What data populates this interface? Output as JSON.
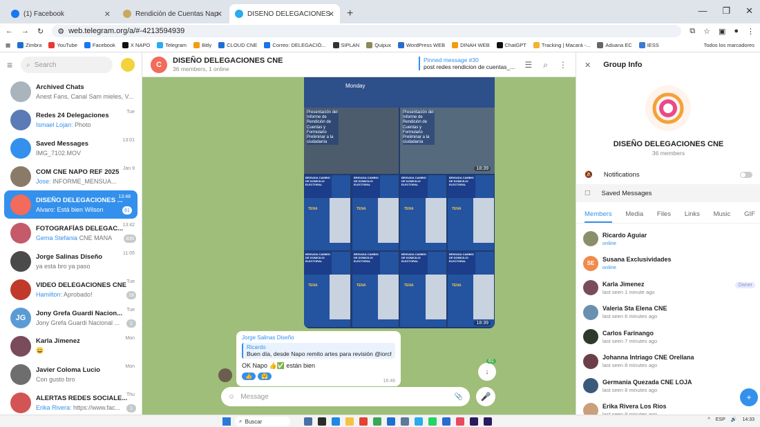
{
  "browser": {
    "tabs": [
      {
        "title": "(1) Facebook",
        "color": "#1877f2"
      },
      {
        "title": "Rendición de Cuentas Napo 20",
        "color": "#c9a95f"
      },
      {
        "title": "DISEÑO DELEGACIONES CNE",
        "color": "#2aabee"
      }
    ],
    "url": "web.telegram.org/a/#-4213594939",
    "bookmarks": [
      "Zimbra",
      "YouTube",
      "Facebook",
      "X NAPO",
      "Telegram",
      "Bitly",
      "CLOUD CNE",
      "Correo: DELEGACIÓ...",
      "SIPLAN",
      "Quipux",
      "WordPress WEB",
      "DINAH WEB",
      "ChatGPT",
      "Tracking | Macará -...",
      "Aduana EC",
      "IESS"
    ],
    "bookmarks_all": "Todos los marcadores"
  },
  "left": {
    "search_placeholder": "Search",
    "chats": [
      {
        "name": "Archived Chats",
        "preview": "Anest Fans, Canal Sam mieles, V...",
        "time": "",
        "badge": "",
        "sender": "",
        "color": "#aab4bd",
        "initials": ""
      },
      {
        "name": "Redes 24 Delegaciones",
        "preview": "Photo",
        "time": "Tue",
        "badge": "",
        "sender": "Ismael Lojan:",
        "color": "#5a7bb5",
        "initials": ""
      },
      {
        "name": "Saved Messages",
        "preview": "IMG_7102.MOV",
        "time": "13:01",
        "badge": "",
        "sender": "",
        "color": "#3390ec",
        "initials": ""
      },
      {
        "name": "COM CNE NAPO REF 2025",
        "preview": "INFORME_MENSUA...",
        "time": "Jan 9",
        "badge": "",
        "sender": "Jose:",
        "color": "#8a7b68",
        "initials": ""
      },
      {
        "name": "DISEÑO DELEGACIONES ...",
        "preview": "Está bien Wilson",
        "time": "13:48",
        "badge": "61",
        "sender": "Alvaro:",
        "color": "#f26b5b",
        "initials": ""
      },
      {
        "name": "FOTOGRAFÍAS DELEGAC...",
        "preview": "CNE MANA",
        "time": "13:42",
        "badge": "835",
        "sender": "Gema Stefania",
        "color": "#c45a6a",
        "initials": ""
      },
      {
        "name": "Jorge Salinas Diseño",
        "preview": "ya esta bro ya paso",
        "time": "11:05",
        "badge": "",
        "sender": "",
        "color": "#4a4a4a",
        "initials": ""
      },
      {
        "name": "VIDEO DELEGACIONES CNE",
        "preview": "Aprobado!",
        "time": "Tue",
        "badge": "18",
        "sender": "Hamilton:",
        "color": "#c0392b",
        "initials": ""
      },
      {
        "name": "Jony Grefa Guardi Nacion...",
        "preview": "Jony Grefa Guardi Nacional ...",
        "time": "Tue",
        "badge": "1",
        "sender": "",
        "color": "#5b9bd5",
        "initials": "JG"
      },
      {
        "name": "Karla Jimenez",
        "preview": "😀",
        "time": "Mon",
        "badge": "",
        "sender": "",
        "color": "#7a4b5a",
        "initials": ""
      },
      {
        "name": "Javier Coloma Lucio",
        "preview": "Con gusto bro",
        "time": "Mon",
        "badge": "",
        "sender": "",
        "color": "#6e6e6e",
        "initials": ""
      },
      {
        "name": "ALERTAS REDES SOCIALE...",
        "preview": "https://www.fac...",
        "time": "Thu",
        "badge": "1",
        "sender": "Erika Rivera:",
        "color": "#d35454",
        "initials": ""
      }
    ]
  },
  "middle": {
    "title": "DISEÑO DELEGACIONES CNE",
    "subtitle": "36 members, 1 online",
    "pinned_title": "Pinned message #30",
    "pinned_text": "post redes rendicion de cuentas_...",
    "photo_label_1": "Monday",
    "photo_caption_1": "Presentación del Informe de Rendición de Cuentas y Formulario Preliminar a la ciudadanía",
    "photo_caption_2": "Presentación del Informe de Rendición de Cuentas y Formulario Preliminar a la ciudadanía",
    "flyer_title": "BRIGADA CAMBIO DE DOMICILIO ELECTORAL",
    "flyer_place": "TENA",
    "photo_time_1": "18:39",
    "photo_time_2": "18:39",
    "message": {
      "from": "Jorge Salinas Diseño",
      "reply_name": "Ricardo",
      "reply_text": "Buen día, desde Napo remito artes para revisión @iorchsalinas",
      "text": "OK Napo 👍✅ están bien",
      "time": "16:46",
      "reactions": [
        "👍",
        "🤗"
      ]
    },
    "scroll_badge": "61",
    "compose_placeholder": "Message"
  },
  "right": {
    "title": "Group Info",
    "group_name": "DISEÑO DELEGACIONES CNE",
    "members_count": "36 members",
    "notifications": "Notifications",
    "saved": "Saved Messages",
    "tabs": [
      "Members",
      "Media",
      "Files",
      "Links",
      "Music",
      "GIF"
    ],
    "members": [
      {
        "name": "Ricardo Aguiar",
        "status": "online",
        "online": true,
        "color": "#8a8f6a",
        "initials": "",
        "owner": ""
      },
      {
        "name": "Susana Exclusividades",
        "status": "online",
        "online": true,
        "color": "#f08a4b",
        "initials": "SE",
        "owner": ""
      },
      {
        "name": "Karla Jimenez",
        "status": "last seen 1 minute ago",
        "online": false,
        "color": "#7a4b5a",
        "initials": "",
        "owner": "Owner"
      },
      {
        "name": "Valeria Sta Elena CNE",
        "status": "last seen 6 minutes ago",
        "online": false,
        "color": "#6a8fb0",
        "initials": "",
        "owner": ""
      },
      {
        "name": "Carlos Farinango",
        "status": "last seen 7 minutes ago",
        "online": false,
        "color": "#2e3a2a",
        "initials": "",
        "owner": ""
      },
      {
        "name": "Johanna Intriago CNE Orellana",
        "status": "last seen 8 minutes ago",
        "online": false,
        "color": "#6b3f4a",
        "initials": "",
        "owner": ""
      },
      {
        "name": "Germania Quezada CNE LOJA",
        "status": "last seen 8 minutes ago",
        "online": false,
        "color": "#3b5a7a",
        "initials": "",
        "owner": ""
      },
      {
        "name": "Erika Rivera Los Ríos",
        "status": "last seen 8 minutes ago",
        "online": false,
        "color": "#c9a07a",
        "initials": "",
        "owner": ""
      }
    ]
  },
  "taskbar": {
    "search": "Buscar",
    "lang": "ESP",
    "time": "14:33"
  }
}
